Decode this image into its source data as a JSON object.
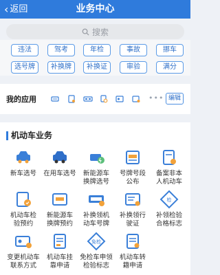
{
  "header": {
    "back_label": "返回",
    "title": "业务中心"
  },
  "search": {
    "placeholder": "搜索"
  },
  "tags": [
    "违法",
    "驾考",
    "年检",
    "事故",
    "挪车",
    "选号牌",
    "补换牌",
    "补换证",
    "审验",
    "满分"
  ],
  "my_apps": {
    "label": "我的应用",
    "icons": [
      "license-plate-icon",
      "vehicle-doc-icon",
      "plate-number-icon",
      "document-stamp-icon",
      "id-card-icon",
      "id-card-add-icon"
    ],
    "more": "•••",
    "edit_label": "编辑"
  },
  "vehicle_business": {
    "title": "机动车业务",
    "services": [
      {
        "label": "新车选号",
        "icon": "new-car-icon"
      },
      {
        "label": "在用车选号",
        "icon": "car-in-use-icon"
      },
      {
        "label": "新能源车\n换牌选号",
        "icon": "ev-plate-icon"
      },
      {
        "label": "号牌号段\n公布",
        "icon": "plate-range-icon"
      },
      {
        "label": "备案非本\n人机动车",
        "icon": "filing-doc-icon"
      },
      {
        "label": "机动车检\n验预约",
        "icon": "inspection-booking-icon"
      },
      {
        "label": "新能源车\n换牌预约",
        "icon": "ev-booking-icon"
      },
      {
        "label": "补换领机\n动车号牌",
        "icon": "replace-plate-icon"
      },
      {
        "label": "补换领行\n驶证",
        "icon": "replace-license-icon"
      },
      {
        "label": "补领检验\n合格标志",
        "icon": "inspection-mark-icon"
      },
      {
        "label": "变更机动车\n联系方式",
        "icon": "contact-change-icon"
      },
      {
        "label": "机动车挂\n靠申请",
        "icon": "affiliation-doc-icon"
      },
      {
        "label": "免检车申领\n检验标志",
        "icon": "exempt-mark-icon"
      },
      {
        "label": "机动车转\n籍申请",
        "icon": "transfer-doc-icon"
      }
    ]
  },
  "colors": {
    "primary": "#2f7bdc",
    "accent_orange": "#f2a23a",
    "background": "#eef1f6"
  }
}
